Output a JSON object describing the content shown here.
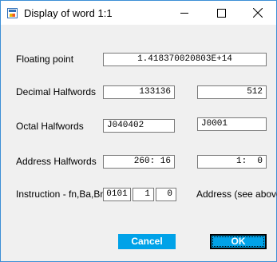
{
  "window": {
    "title": "Display of word 1:1",
    "icon": "app-icon",
    "controls": {
      "minimize": "minimize-icon",
      "maximize": "maximize-icon",
      "close": "close-icon"
    }
  },
  "fields": {
    "floating_point": {
      "label": "Floating point",
      "value": "1.418370020803E+14"
    },
    "decimal_halfwords": {
      "label": "Decimal Halfwords",
      "left": "133136",
      "right": "512"
    },
    "octal_halfwords": {
      "label": "Octal Halfwords",
      "left": "J040402",
      "right": "J0001"
    },
    "address_halfwords": {
      "label": "Address Halfwords",
      "left": "260: 16",
      "right": "1:  0"
    },
    "instruction": {
      "label": "Instruction - fn,Ba,Bm",
      "fn": "0101",
      "ba": "1",
      "bm": "0",
      "note": "Address (see above)"
    }
  },
  "buttons": {
    "cancel": "Cancel",
    "ok": "OK"
  },
  "colors": {
    "button_accent": "#00a2e8",
    "window_border": "#3c8fd6"
  }
}
